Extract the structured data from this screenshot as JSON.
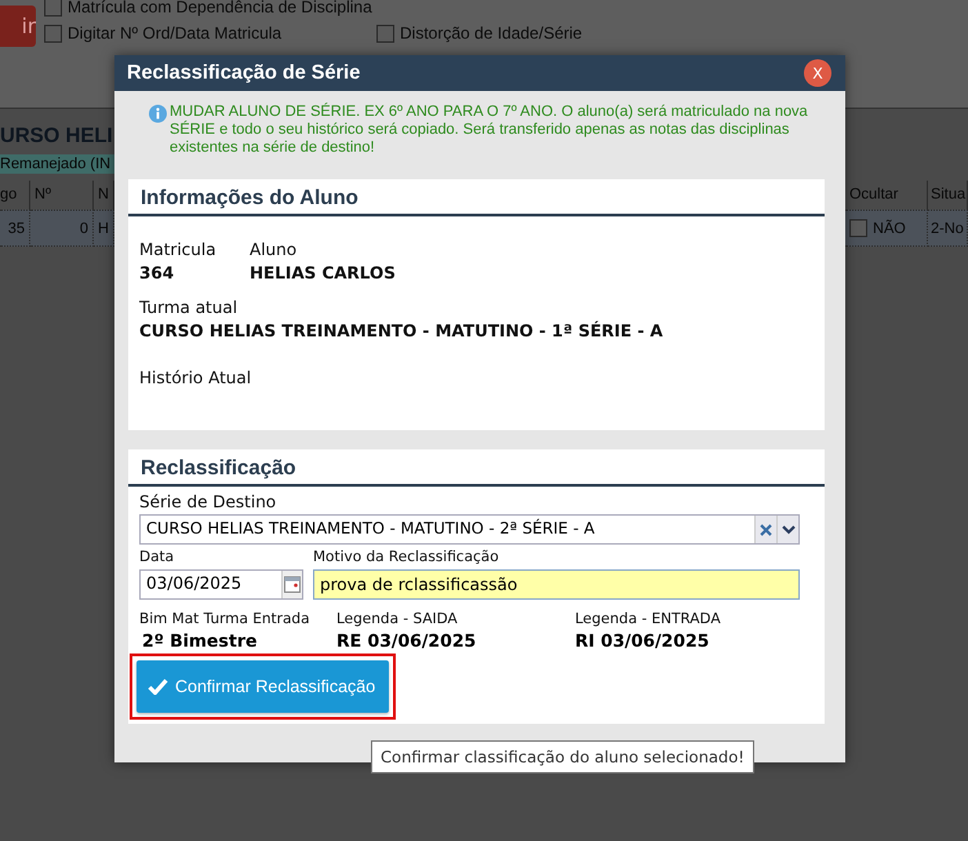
{
  "background": {
    "exit_button": "ir",
    "option_rows": [
      [
        {
          "label": "Matrícula com Dependência de Disciplina",
          "checked": false
        }
      ],
      [
        {
          "label": "Digitar Nº Ord/Data Matricula",
          "checked": false
        },
        {
          "label": "Distorção de Idade/Série",
          "checked": false
        }
      ]
    ],
    "title": "URSO HELI",
    "group_bar": "Remanejado (IN",
    "table": {
      "columns": [
        "go",
        "Nº",
        "N",
        "Ocultar",
        "Situa"
      ],
      "rows": [
        {
          "cells": [
            "35",
            "0",
            "H",
            "NÃO",
            "2-No"
          ],
          "hidden": false
        }
      ]
    }
  },
  "dialog": {
    "title": "Reclassificação de Série",
    "close": "X",
    "notice": "MUDAR ALUNO DE SÉRIE. EX 6º ANO PARA O 7º ANO. O aluno(a) será matriculado na nova SÉRIE e todo o seu histórico será copiado. Será transferido apenas as notas das disciplinas existentes na série de destino!",
    "student_info": {
      "heading": "Informações do Aluno",
      "fields": [
        {
          "label": "Matricula",
          "value": "364"
        },
        {
          "label": "Aluno",
          "value": "HELIAS CARLOS"
        }
      ],
      "current_class": {
        "label": "Turma atual",
        "value": "CURSO HELIAS TREINAMENTO - MATUTINO - 1ª SÉRIE - A"
      },
      "history_label": "Histório Atual"
    },
    "reclassification": {
      "heading": "Reclassificação",
      "destination": {
        "label": "Série de Destino",
        "value": "CURSO HELIAS TREINAMENTO - MATUTINO - 2ª SÉRIE - A"
      },
      "date": {
        "label": "Data",
        "value": "03/06/2025"
      },
      "reason": {
        "label": "Motivo da Reclassificação",
        "value": "prova de rclassificassão"
      },
      "legends": [
        {
          "label": "Bim Mat Turma Entrada",
          "value": "2º Bimestre"
        },
        {
          "label": "Legenda - SAIDA",
          "value": "RE 03/06/2025"
        },
        {
          "label": "Legenda - ENTRADA",
          "value": "RI 03/06/2025"
        }
      ],
      "confirm_button": {
        "label": "Confirmar Reclassificação",
        "highlighted": true,
        "tooltip": "Confirmar classificação do aluno selecionado!"
      }
    }
  }
}
